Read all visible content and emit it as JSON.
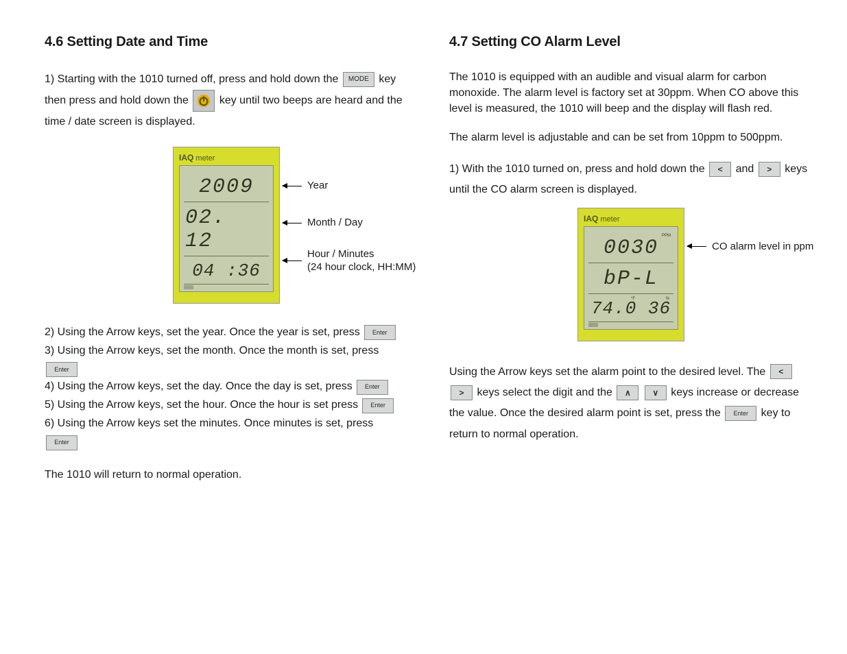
{
  "buttons": {
    "mode": "MODE",
    "enter": "Enter",
    "left": "<",
    "right": ">",
    "up": "∧",
    "down": "∨"
  },
  "left": {
    "heading": "4.6 Setting Date and Time",
    "p1a": "1) Starting with the 1010 turned off, press and hold down the ",
    "p1b": " key then press and hold down the ",
    "p1c": " key until two beeps are heard and the time / date screen is displayed.",
    "meter": {
      "title_bold": "IAQ",
      "title_rest": " meter",
      "row1": "2009",
      "row2": "02. 12",
      "row3": "04 :36",
      "label1": "Year",
      "label2": "Month / Day",
      "label3a": "Hour / Minutes",
      "label3b": "(24 hour clock, HH:MM)"
    },
    "steps": {
      "s2": "2) Using the Arrow keys, set the year. Once the year is set, press ",
      "s3": "3) Using the Arrow keys, set the month. Once the month is set, press ",
      "s4": "4) Using the Arrow keys, set the day. Once the day is set, press ",
      "s5": "5) Using the Arrow keys, set the hour. Once the hour is set press ",
      "s6": "6) Using the Arrow keys set the minutes. Once minutes is set, press "
    },
    "footer": "The 1010 will return to normal operation."
  },
  "right": {
    "heading": "4.7 Setting CO Alarm Level",
    "p1": "The 1010 is equipped with an audible and visual alarm for carbon monoxide. The alarm level is factory set at 30ppm. When CO above this level is measured, the 1010 will beep and the display will flash red.",
    "p2": "The alarm level is adjustable and can be set from 10ppm to 500ppm.",
    "s1a": "1) With the 1010 turned on, press and hold down the ",
    "s1b": " and ",
    "s1c": " keys until the CO alarm screen is displayed.",
    "meter": {
      "title_bold": "IAQ",
      "title_rest": " meter",
      "ppm": "PPM",
      "row1": "0030",
      "row2": "bP-L",
      "row3": "74.0 36",
      "degf": "°F",
      "pct": "%",
      "label1": "CO alarm level in ppm"
    },
    "p3a": "Using the Arrow keys set the alarm point to the desired level. The ",
    "p3b": " keys select the digit and the ",
    "p3c": " keys increase or decrease the value. Once the desired alarm point is set, press the ",
    "p3d": " key to return to normal operation."
  }
}
